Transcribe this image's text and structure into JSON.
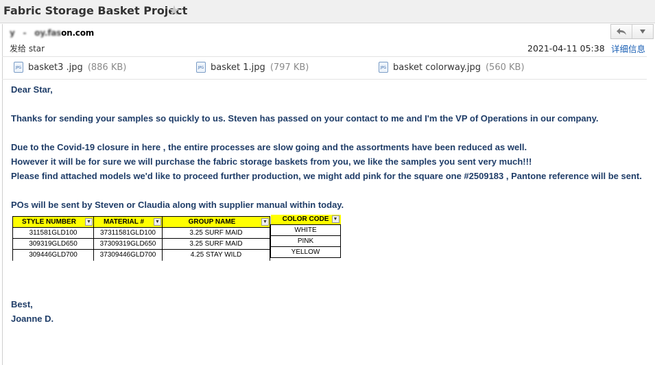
{
  "window": {
    "title": "Fabric Storage Basket Project"
  },
  "header": {
    "sender_partial": "on.com",
    "recipient": "发给 star",
    "date": "2021-04-11  05:38",
    "details_link": "详细信息"
  },
  "attachments": [
    {
      "name": "basket3 .jpg",
      "size": "(886 KB)"
    },
    {
      "name": "basket 1.jpg",
      "size": "(797 KB)"
    },
    {
      "name": "basket colorway.jpg",
      "size": "(560 KB)"
    }
  ],
  "body": {
    "greeting": "Dear Star,",
    "p1": "Thanks for sending your samples so quickly to us.  Steven has passed on your contact to me and I'm the VP of Operations in our company.",
    "p2_l1": "Due to the Covid-19 closure in here , the entire processes are slow going and the assortments have been reduced as well.",
    "p2_l2": "However it will be for sure we will purchase the fabric storage baskets from you, we like the samples you sent very much!!!",
    "p2_l3": "Please find attached models we'd like to proceed further production, we might add pink for the square one #2509183 , Pantone reference will be sent.",
    "p3": "POs will be sent by Steven or Claudia along with supplier manual within today.",
    "closing": "Best,",
    "signature": "Joanne D."
  },
  "po_table": {
    "headers": [
      "STYLE NUMBER",
      "MATERIAL #",
      "GROUP NAME"
    ],
    "rows": [
      [
        "311581GLD100",
        "37311581GLD100",
        "3.25 SURF MAID"
      ],
      [
        "309319GLD650",
        "37309319GLD650",
        "3.25 SURF MAID"
      ],
      [
        "309446GLD700",
        "37309446GLD700",
        "4.25 STAY WILD"
      ]
    ]
  },
  "color_table": {
    "header": "COLOR CODE",
    "rows": [
      "WHITE",
      "PINK",
      "YELLOW"
    ]
  },
  "icons": {
    "star": "star-icon",
    "reply": "reply-icon",
    "more": "chevron-down-icon",
    "attachment": "jpg-file-icon",
    "dropdown": "filter-dropdown-icon"
  }
}
